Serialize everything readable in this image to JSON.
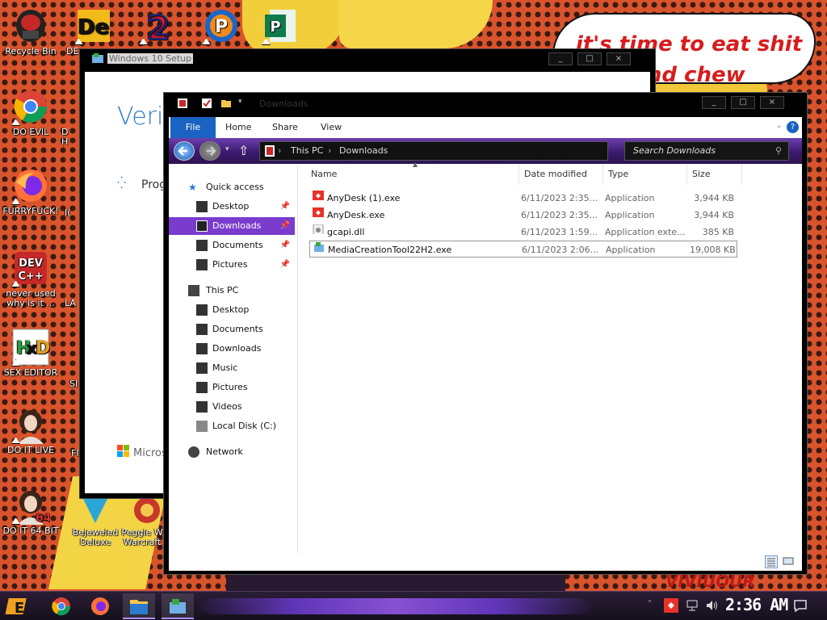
{
  "wallpaper": {
    "speech_line1": "it's time to eat shit",
    "speech_line2": "and chew",
    "bottom_text": "VIVIUOUR"
  },
  "desktop_icons": [
    {
      "label": "Recycle Bin"
    },
    {
      "label": "DO EVIL"
    },
    {
      "label": "FURRYFUCK!"
    },
    {
      "label": "never used why is it ..."
    },
    {
      "label": "SEX EDITOR"
    },
    {
      "label": "DO IT LIVE"
    },
    {
      "label": "DO IT 64 BIT"
    },
    {
      "label": "Bejeweled Deluxe"
    },
    {
      "label": "Peggle W Warcraft"
    }
  ],
  "partial_labels": {
    "de": "DE",
    "d": "D",
    "h": "H",
    "i": "I(",
    "la": "LA",
    "si": "SI",
    "fi": "FI"
  },
  "setup_window": {
    "title": "Windows 10 Setup",
    "heading": "Verif",
    "progress": "Prog",
    "brand": "Micros"
  },
  "explorer": {
    "title": "Downloads",
    "ribbon_tabs": [
      "File",
      "Home",
      "Share",
      "View"
    ],
    "breadcrumb": [
      "This PC",
      "Downloads"
    ],
    "search_placeholder": "Search Downloads",
    "nav": {
      "quick_access": "Quick access",
      "qa_items": [
        "Desktop",
        "Downloads",
        "Documents",
        "Pictures"
      ],
      "this_pc": "This PC",
      "pc_items": [
        "Desktop",
        "Documents",
        "Downloads",
        "Music",
        "Pictures",
        "Videos",
        "Local Disk (C:)"
      ],
      "network": "Network"
    },
    "columns": {
      "name": "Name",
      "date": "Date modified",
      "type": "Type",
      "size": "Size"
    },
    "files": [
      {
        "name": "AnyDesk (1).exe",
        "date": "6/11/2023 2:35...",
        "type": "Application",
        "size": "3,944 KB",
        "icon": "anydesk-icon"
      },
      {
        "name": "AnyDesk.exe",
        "date": "6/11/2023 2:35...",
        "type": "Application",
        "size": "3,944 KB",
        "icon": "anydesk-icon"
      },
      {
        "name": "gcapi.dll",
        "date": "6/11/2023 1:59...",
        "type": "Application exte...",
        "size": "385 KB",
        "icon": "dll-icon"
      },
      {
        "name": "MediaCreationTool22H2.exe",
        "date": "6/11/2023 2:06...",
        "type": "Application",
        "size": "19,008 KB",
        "icon": "media-creation-icon"
      }
    ]
  },
  "taskbar": {
    "clock": "2:36 AM",
    "apps": [
      "start-icon",
      "chrome-icon",
      "firefox-icon",
      "file-explorer-icon",
      "windows-setup-icon"
    ]
  },
  "colors": {
    "accent": "#7a3ccd",
    "file_tab": "#1a63c2",
    "wallpaper_orange": "#d9542c"
  }
}
